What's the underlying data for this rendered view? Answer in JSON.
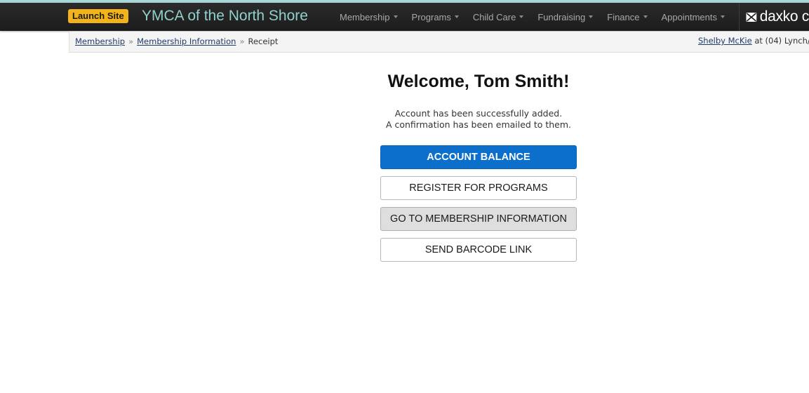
{
  "header": {
    "launch_site_label": "Launch Site",
    "brand_title": "YMCA of the North Shore",
    "menu": [
      {
        "label": "Membership"
      },
      {
        "label": "Programs"
      },
      {
        "label": "Child Care"
      },
      {
        "label": "Fundraising"
      },
      {
        "label": "Finance"
      },
      {
        "label": "Appointments"
      }
    ],
    "logo_text": "daxko c",
    "colors": {
      "top_strip": "#a9d7d6",
      "navbar": "#222222",
      "brand_title": "#8fd1cc",
      "launch_button": "#f3b31b"
    }
  },
  "breadcrumb": {
    "items": [
      "Membership",
      "Membership Information"
    ],
    "separator": "»",
    "current": "Receipt"
  },
  "user": {
    "name": "Shelby McKie",
    "location_text": "at (04) Lynch/"
  },
  "main": {
    "welcome_title": "Welcome, Tom Smith!",
    "message_line1": "Account has been successfully added.",
    "message_line2": "A confirmation has been emailed to them.",
    "buttons": [
      {
        "label": "ACCOUNT BALANCE",
        "style": "primary",
        "color": "#0c6fcb"
      },
      {
        "label": "REGISTER FOR PROGRAMS",
        "style": "outline"
      },
      {
        "label": "GO TO MEMBERSHIP INFORMATION",
        "style": "grey"
      },
      {
        "label": "SEND BARCODE LINK",
        "style": "outline"
      }
    ]
  }
}
